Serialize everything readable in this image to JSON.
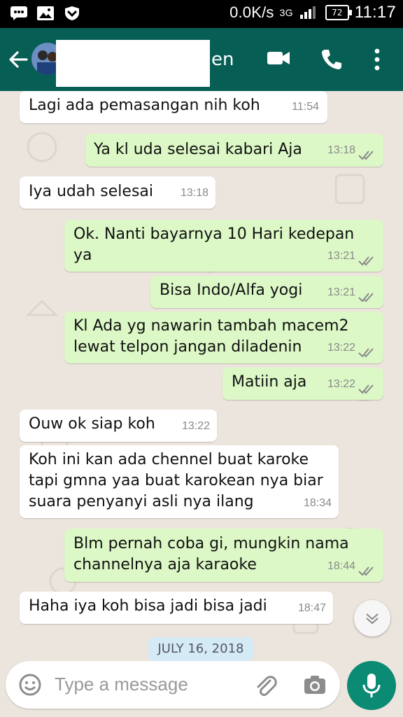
{
  "status_bar": {
    "speed": "0.0K/s",
    "network": "3G",
    "battery": "72",
    "time": "11:17"
  },
  "header": {
    "name_visible_tail": "en"
  },
  "messages": [
    {
      "dir": "in",
      "text": "Lagi ada pemasangan nih koh",
      "time": "11:54"
    },
    {
      "dir": "out",
      "text": "Ya kl uda selesai kabari Aja",
      "time": "13:18"
    },
    {
      "dir": "in",
      "text": "Iya udah selesai",
      "time": "13:18"
    },
    {
      "dir": "out",
      "text": "Ok. Nanti bayarnya 10 Hari kedepan ya",
      "time": "13:21"
    },
    {
      "dir": "out",
      "text": "Bisa Indo/Alfa yogi",
      "time": "13:21"
    },
    {
      "dir": "out",
      "text": "Kl Ada yg nawarin tambah macem2 lewat telpon jangan diladenin",
      "time": "13:22"
    },
    {
      "dir": "out",
      "text": "Matiin aja",
      "time": "13:22"
    },
    {
      "dir": "in",
      "text": "Ouw ok siap koh",
      "time": "13:22"
    },
    {
      "dir": "in",
      "text": "Koh ini kan ada chennel buat karoke tapi gmna yaa buat karokean nya biar suara penyanyi asli nya ilang",
      "time": "18:34"
    },
    {
      "dir": "out",
      "text": "Blm pernah coba gi, mungkin nama channelnya aja karaoke",
      "time": "18:44"
    },
    {
      "dir": "in",
      "text": "Haha iya koh bisa jadi bisa jadi",
      "time": "18:47"
    }
  ],
  "date_chip": "JULY 16, 2018",
  "composer": {
    "placeholder": "Type a message"
  },
  "colors": {
    "header": "#075e54",
    "incoming": "#ffffff",
    "outgoing": "#dcf8c6",
    "mic_button": "#0b8a74"
  }
}
